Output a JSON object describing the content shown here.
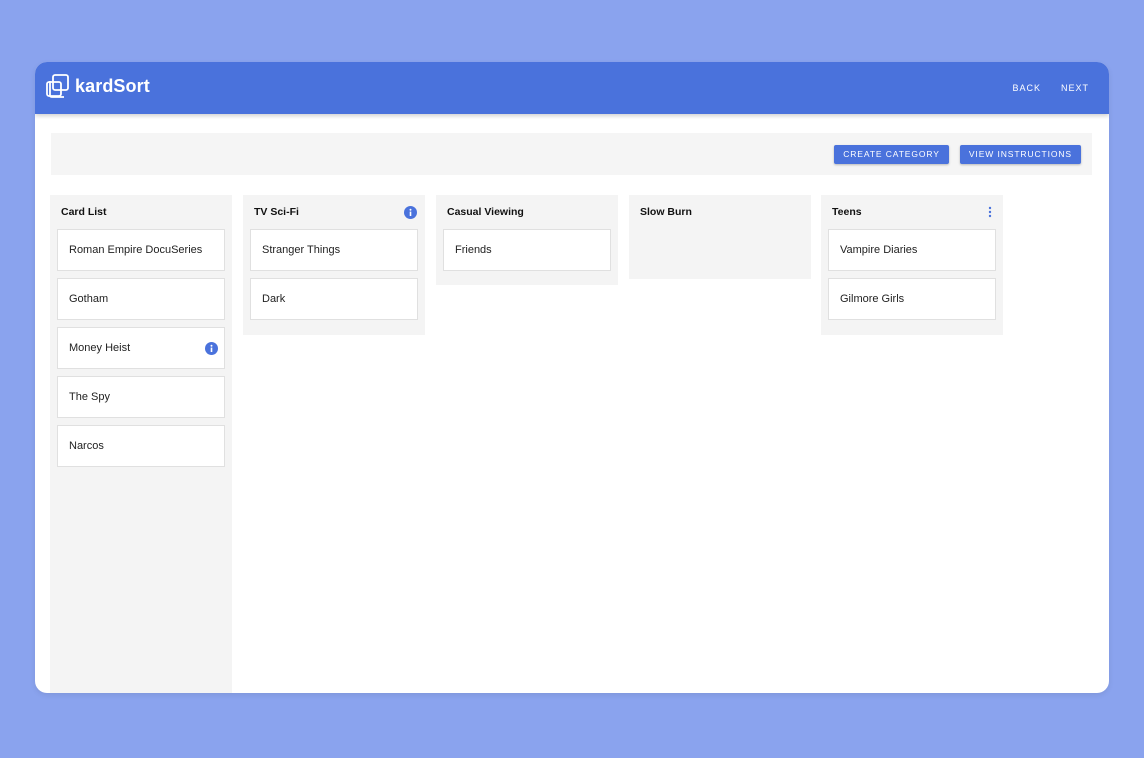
{
  "app": {
    "brand": "kardSort",
    "accent": "#4a72dc",
    "background": "#8aa3ee"
  },
  "nav": {
    "back_label": "BACK",
    "next_label": "NEXT"
  },
  "toolbar": {
    "create_category_label": "CREATE CATEGORY",
    "view_instructions_label": "VIEW INSTRUCTIONS"
  },
  "columns": [
    {
      "title": "Card List",
      "icon": "none",
      "cards": [
        {
          "label": "Roman Empire DocuSeries",
          "icon": "none"
        },
        {
          "label": "Gotham",
          "icon": "none"
        },
        {
          "label": "Money Heist",
          "icon": "info-icon"
        },
        {
          "label": "The Spy",
          "icon": "none"
        },
        {
          "label": "Narcos",
          "icon": "none"
        }
      ]
    },
    {
      "title": "TV Sci-Fi",
      "icon": "info-icon",
      "cards": [
        {
          "label": "Stranger Things",
          "icon": "none"
        },
        {
          "label": "Dark",
          "icon": "none"
        }
      ]
    },
    {
      "title": "Casual Viewing",
      "icon": "none",
      "cards": [
        {
          "label": "Friends",
          "icon": "none"
        }
      ]
    },
    {
      "title": "Slow Burn",
      "icon": "none",
      "cards": []
    },
    {
      "title": "Teens",
      "icon": "more-vert-icon",
      "cards": [
        {
          "label": "Vampire Diaries",
          "icon": "none"
        },
        {
          "label": "Gilmore Girls",
          "icon": "none"
        }
      ]
    }
  ]
}
